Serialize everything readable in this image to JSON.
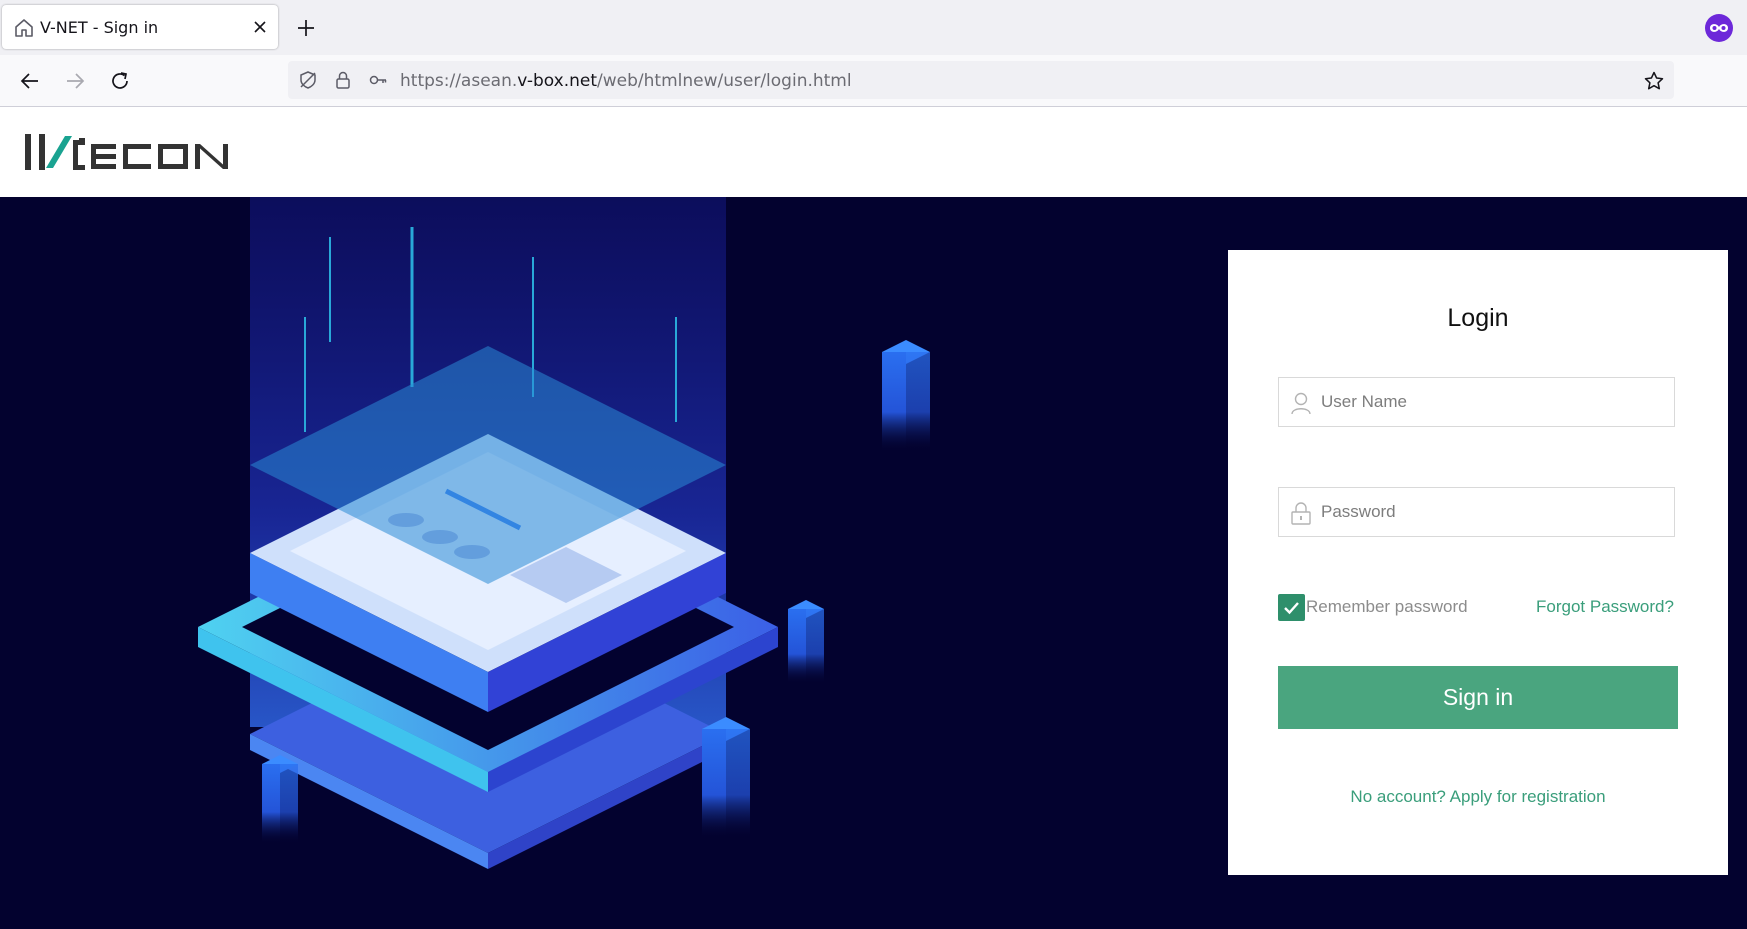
{
  "browser": {
    "tab_title": "V-NET - Sign in",
    "url_prefix": "https://asean.",
    "url_domain": "v-box.net",
    "url_path": "/web/htmlnew/user/login.html"
  },
  "brand": {
    "logo_text": "WECON",
    "accent_color": "#4aa57f",
    "link_color": "#3a9e7b",
    "hero_background": "#03022f"
  },
  "login": {
    "title": "Login",
    "username_placeholder": "User Name",
    "password_placeholder": "Password",
    "remember_label": "Remember password",
    "remember_checked": true,
    "forgot_label": "Forgot Password?",
    "signin_label": "Sign in",
    "register_label": "No account? Apply for registration"
  },
  "icons": {
    "tab": "home-icon",
    "close": "close-icon",
    "new_tab": "plus-icon",
    "back": "back-arrow-icon",
    "forward": "forward-arrow-icon",
    "reload": "reload-icon",
    "tracking": "shield-icon",
    "lock": "lock-icon",
    "key": "key-icon",
    "bookmark": "star-icon",
    "user": "user-icon",
    "password": "padlock-icon",
    "check": "check-icon",
    "extension": "extension-icon"
  }
}
